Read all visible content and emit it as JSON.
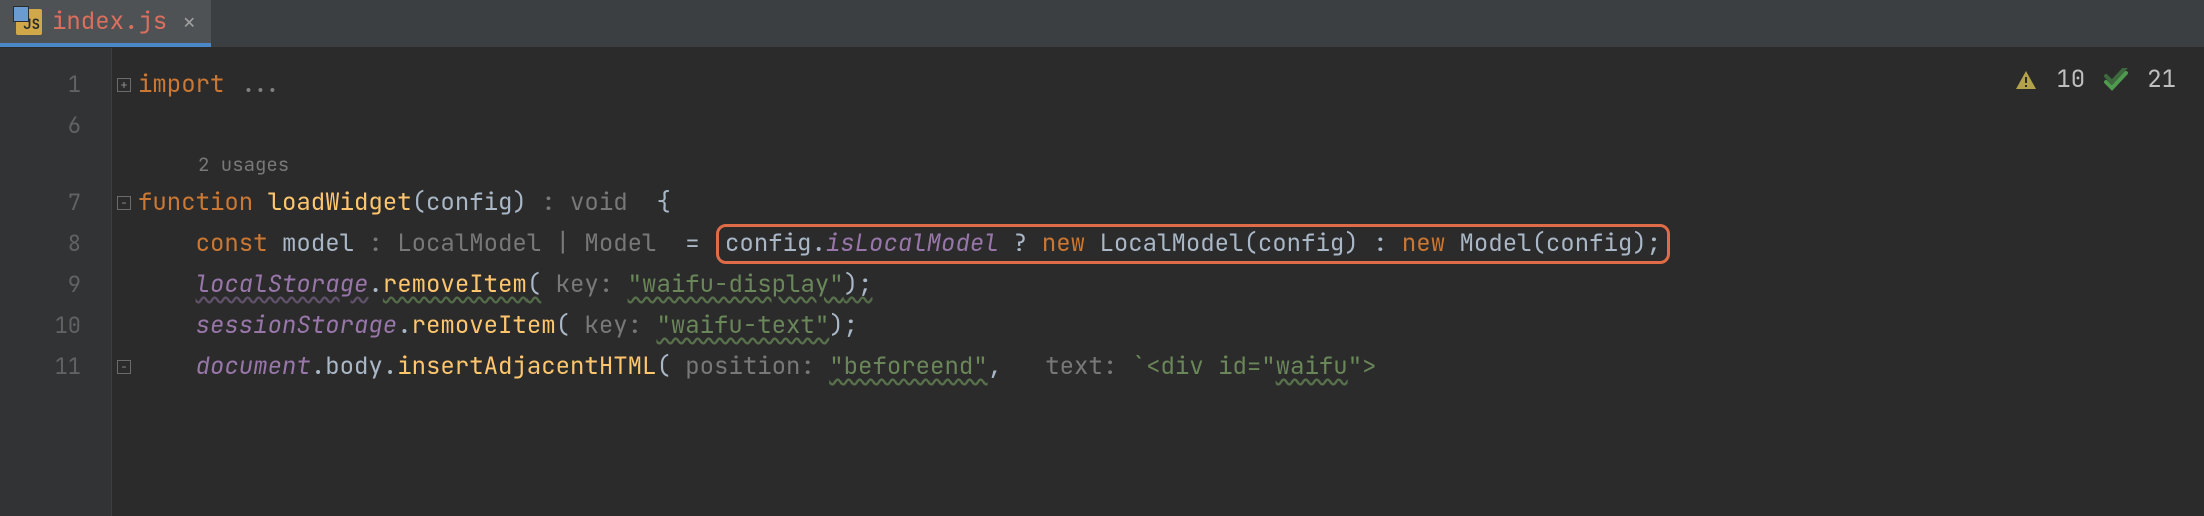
{
  "tab": {
    "filename": "index.js"
  },
  "inspections": {
    "warnings": "10",
    "weak": "21"
  },
  "gutter": [
    "1",
    "6",
    "",
    "7",
    "8",
    "9",
    "10",
    "11"
  ],
  "usages": "2 usages",
  "line1": {
    "kw": "import",
    "dots": "..."
  },
  "line7": {
    "kw": "function",
    "name": "loadWidget",
    "paramsOpen": "(",
    "param": "config",
    "paramsClose": ")",
    "retHint": " : void  ",
    "brace": "{"
  },
  "line8": {
    "indent": "    ",
    "kw": "const",
    "varname": "model",
    "typeHint": " : LocalModel | Model  ",
    "eq": "= ",
    "expr_config": "config",
    "dot1": ".",
    "expr_prop": "isLocalModel",
    "tern1": " ? ",
    "new1": "new",
    "class1": "LocalModel",
    "open1": "(",
    "arg1": "config",
    "close1": ")",
    "colon": " : ",
    "new2": "new",
    "class2": "Model",
    "open2": "(",
    "arg2": "config",
    "close2": ")",
    "semi": ";"
  },
  "line9": {
    "indent": "    ",
    "obj": "localStorage",
    "dot": ".",
    "method": "removeItem",
    "open": "(",
    "hint": " key: ",
    "str": "\"waifu-display\"",
    "close": ");"
  },
  "line10": {
    "indent": "    ",
    "obj": "sessionStorage",
    "dot": ".",
    "method": "removeItem",
    "open": "(",
    "hint": " key: ",
    "str": "\"waifu-text\"",
    "close": ");"
  },
  "line11": {
    "indent": "    ",
    "obj": "document",
    "dot1": ".",
    "body": "body",
    "dot2": ".",
    "method": "insertAdjacentHTML",
    "open": "(",
    "hint1": " position: ",
    "str1": "\"beforeend\"",
    "comma": ",  ",
    "hint2": " text: ",
    "tick": "`",
    "html_open": "<div id=\"",
    "html_id": "waifu",
    "html_close": "\">"
  }
}
